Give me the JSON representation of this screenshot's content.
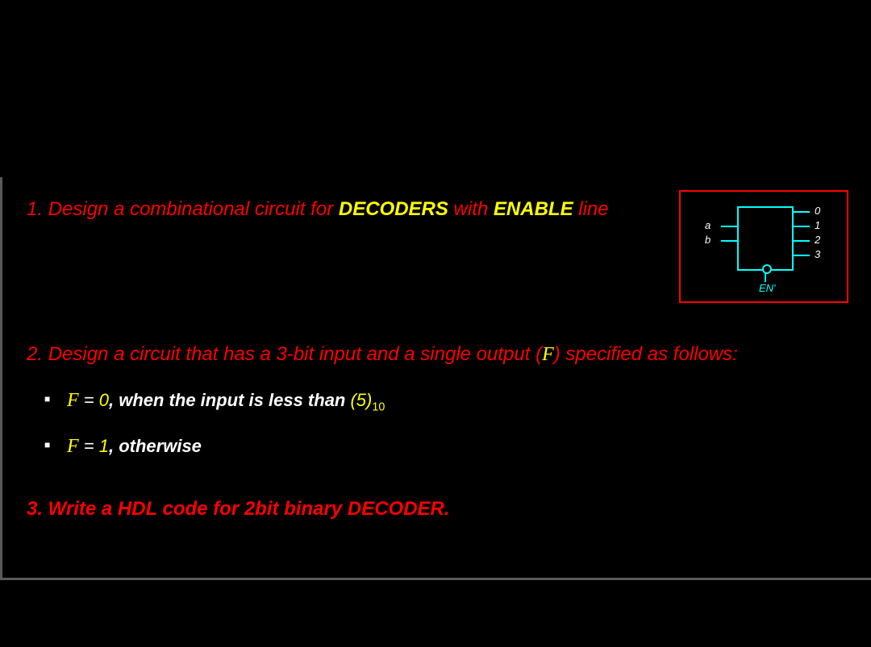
{
  "q1": {
    "num": "1.  ",
    "part1": "Design a combinational circuit for ",
    "part2_bold": "DECODERS",
    "part3": " with ",
    "part4_bold": "ENABLE",
    "part5": " line"
  },
  "diagram": {
    "in_a": "a",
    "in_b": "b",
    "enable": "EN'",
    "out0": "0",
    "out1": "1",
    "out2": "2",
    "out3": "3"
  },
  "q2": {
    "num": "2. ",
    "part1": "Design a circuit that has a 3-bit input and a single output ",
    "paren_open": "(",
    "fvar": "F",
    "paren_close": ")",
    "part2": " specified as follows:",
    "bullet1_F": "F",
    "bullet1_eq": "  =  ",
    "bullet1_val": "0",
    "bullet1_txt": ", when the input is less than ",
    "bullet1_five": "(5)",
    "bullet1_sub": "10",
    "bullet2_F": "F",
    "bullet2_eq": "  =  ",
    "bullet2_val": "1",
    "bullet2_txt": ", otherwise"
  },
  "q3": {
    "text": "3.  Write a HDL code for 2bit binary DECODER."
  }
}
